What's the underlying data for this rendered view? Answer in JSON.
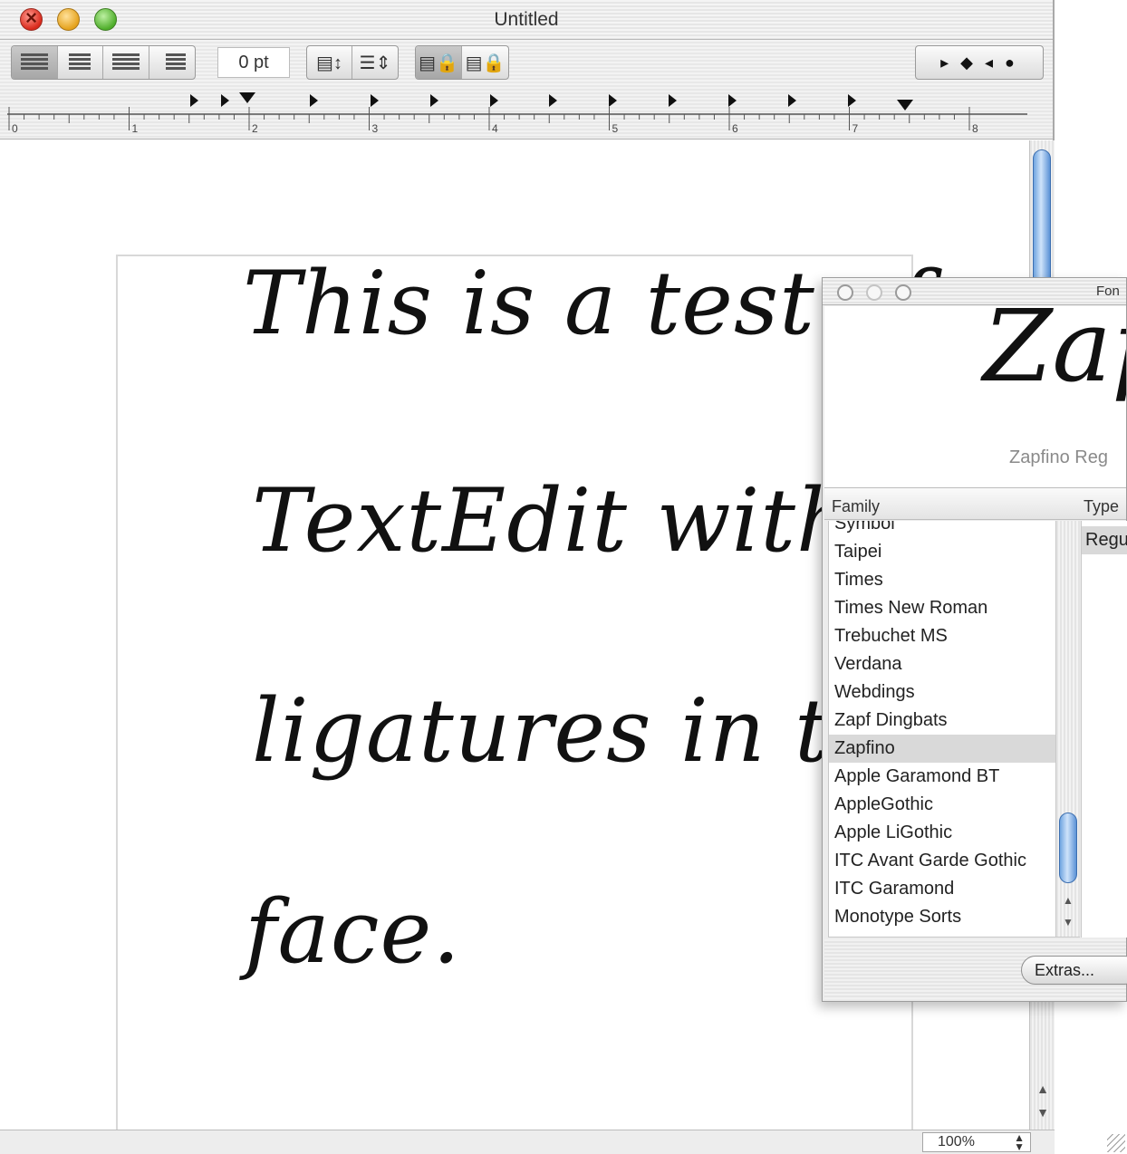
{
  "window": {
    "title": "Untitled"
  },
  "toolbar": {
    "spacing_value": "0 pt",
    "tab_markers": "▸ ◆ ◂ ●"
  },
  "ruler": {
    "numbers": [
      "0",
      "1",
      "2",
      "3",
      "4",
      "5",
      "6",
      "7",
      "8"
    ]
  },
  "document": {
    "lines": [
      "This is a test of",
      "TextEdit with",
      "ligatures in type",
      "face."
    ]
  },
  "statusbar": {
    "zoom": "100%"
  },
  "font_panel": {
    "title": "Fon",
    "preview_text": "Zap",
    "preview_label": "Zapfino Reg",
    "family_header": "Family",
    "typeface_header": "Type",
    "families": [
      "Symbol",
      "Taipei",
      "Times",
      "Times New Roman",
      "Trebuchet MS",
      "Verdana",
      "Webdings",
      "Zapf Dingbats",
      "Zapfino",
      "Apple Garamond BT",
      "AppleGothic",
      "Apple LiGothic",
      "ITC Avant Garde Gothic",
      "ITC Garamond",
      "Monotype Sorts"
    ],
    "selected_family": "Zapfino",
    "typeface_selected": "Regu",
    "extras_label": "Extras..."
  },
  "colors": {
    "selection": "#d9d9d9",
    "scroll_thumb": "#6fa4e0"
  }
}
